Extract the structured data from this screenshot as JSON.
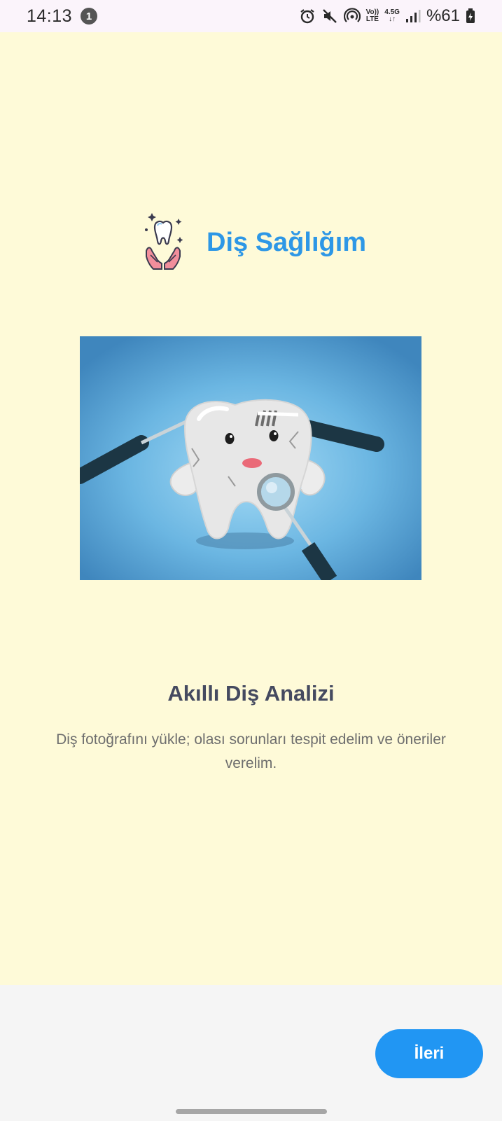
{
  "status_bar": {
    "time": "14:13",
    "notification_count": "1",
    "volte_label_top": "Vo))",
    "volte_label_bottom": "LTE",
    "network_label_top": "4.5G",
    "network_label_bottom": "↓↑",
    "battery": "%61",
    "icons": [
      "alarm-icon",
      "mute-icon",
      "hotspot-icon",
      "volte-icon",
      "network-icon",
      "signal-icon",
      "battery-icon"
    ]
  },
  "brand": {
    "logo_icon": "tooth-hands-icon",
    "title": "Diş Sağlığım"
  },
  "hero": {
    "illustration": "tooth-dental-tools-illustration"
  },
  "onboarding": {
    "headline": "Akıllı Diş Analizi",
    "description": "Diş fotoğrafını yükle; olası sorunları tespit edelim ve öneriler verelim."
  },
  "actions": {
    "next_label": "İleri"
  },
  "colors": {
    "background": "#fefad8",
    "brand": "#2d97e6",
    "button": "#2196f3",
    "headline": "#454a60",
    "body_text": "#6e6e6e",
    "bottom_area": "#f5f5f5"
  }
}
